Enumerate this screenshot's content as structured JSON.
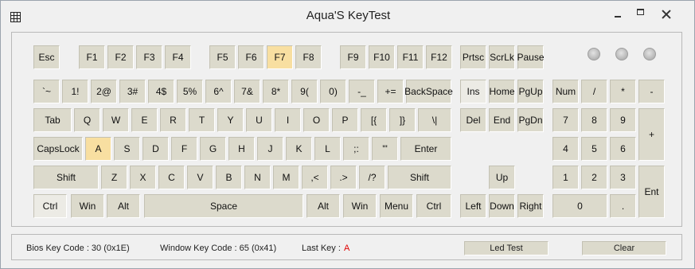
{
  "window": {
    "title": "Aqua'S KeyTest",
    "icon": "keyboard-grid-icon"
  },
  "keys": {
    "esc": "Esc",
    "f1": "F1",
    "f2": "F2",
    "f3": "F3",
    "f4": "F4",
    "f5": "F5",
    "f6": "F6",
    "f7": "F7",
    "f8": "F8",
    "f9": "F9",
    "f10": "F10",
    "f11": "F11",
    "f12": "F12",
    "prtsc": "Prtsc",
    "scrlk": "ScrLk",
    "pause": "Pause",
    "backtick": "`~",
    "d1": "1!",
    "d2": "2@",
    "d3": "3#",
    "d4": "4$",
    "d5": "5%",
    "d6": "6^",
    "d7": "7&",
    "d8": "8*",
    "d9": "9(",
    "d0": "0)",
    "minus": "-_",
    "equals": "+=",
    "backspace": "BackSpace",
    "ins": "Ins",
    "home": "Home",
    "pgup": "PgUp",
    "numlock": "Num",
    "numdiv": "/",
    "nummul": "*",
    "numsub": "-",
    "tab": "Tab",
    "q": "Q",
    "w": "W",
    "e": "E",
    "r": "R",
    "t": "T",
    "y": "Y",
    "u": "U",
    "i": "I",
    "o": "O",
    "p": "P",
    "lbracket": "[{",
    "rbracket": "]}",
    "backslash": "\\|",
    "del": "Del",
    "end": "End",
    "pgdn": "PgDn",
    "num7": "7",
    "num8": "8",
    "num9": "9",
    "numadd": "+",
    "capslock": "CapsLock",
    "a": "A",
    "s": "S",
    "d": "D",
    "f": "F",
    "g": "G",
    "h": "H",
    "j": "J",
    "k": "K",
    "l": "L",
    "semicolon": ";:",
    "quote": "'\"",
    "enter": "Enter",
    "num4": "4",
    "num5": "5",
    "num6": "6",
    "lshift": "Shift",
    "z": "Z",
    "x": "X",
    "c": "C",
    "v": "V",
    "b": "B",
    "n": "N",
    "m": "M",
    "comma": ",<",
    "period": ".>",
    "slash": "/?",
    "rshift": "Shift",
    "up": "Up",
    "num1": "1",
    "num2": "2",
    "num3": "3",
    "numenter": "Ent",
    "lctrl": "Ctrl",
    "lwin": "Win",
    "lalt": "Alt",
    "space": "Space",
    "ralt": "Alt",
    "rwin": "Win",
    "menu": "Menu",
    "rctrl": "Ctrl",
    "left": "Left",
    "down": "Down",
    "right": "Right",
    "num0": "0",
    "numdot": "."
  },
  "pressed_keys": [
    "F7",
    "A"
  ],
  "highlight_color": "#f8dfa1",
  "status": {
    "bios_key_code": "Bios Key Code : 30 (0x1E)",
    "window_key_code": "Window Key Code : 65 (0x41)",
    "last_key_label": "Last Key :",
    "last_key_value": "A",
    "last_key_color": "#e00000",
    "led_test_label": "Led Test",
    "clear_label": "Clear"
  }
}
